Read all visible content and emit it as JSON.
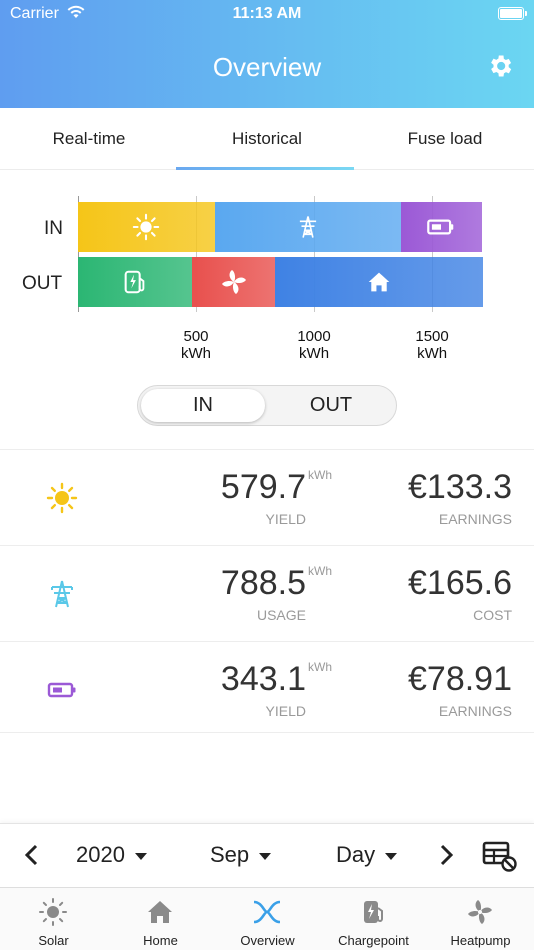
{
  "status_bar": {
    "carrier": "Carrier",
    "time": "11:13 AM"
  },
  "header": {
    "title": "Overview"
  },
  "tabs": [
    {
      "label": "Real-time"
    },
    {
      "label": "Historical",
      "active": true
    },
    {
      "label": "Fuse load"
    }
  ],
  "chart_data": {
    "type": "bar",
    "orientation": "horizontal-stacked",
    "categories": [
      "IN",
      "OUT"
    ],
    "series": [
      {
        "row": "IN",
        "icon": "sun-icon",
        "value": 579.7,
        "color": "#f5c518"
      },
      {
        "row": "IN",
        "icon": "power-tower-icon",
        "value": 788.5,
        "color": "#5aa8f0"
      },
      {
        "row": "IN",
        "icon": "battery-icon",
        "value": 343.1,
        "color": "#9b59d6"
      },
      {
        "row": "OUT",
        "icon": "charging-station-icon",
        "value": 485,
        "color": "#2bb673"
      },
      {
        "row": "OUT",
        "icon": "fan-icon",
        "value": 350,
        "color": "#e8504d"
      },
      {
        "row": "OUT",
        "icon": "home-icon",
        "value": 880,
        "color": "#3f82e4"
      }
    ],
    "xlim": [
      0,
      1720
    ],
    "xticks": [
      {
        "value": 500,
        "label_top": "500",
        "label_bottom": "kWh"
      },
      {
        "value": 1000,
        "label_top": "1000",
        "label_bottom": "kWh"
      },
      {
        "value": 1500,
        "label_top": "1500",
        "label_bottom": "kWh"
      }
    ],
    "grid": true
  },
  "toggle": {
    "in_label": "IN",
    "out_label": "OUT",
    "selected": "IN"
  },
  "stats": [
    {
      "icon": "sun-icon",
      "value": "579.7",
      "unit": "kWh",
      "value_label": "YIELD",
      "money": "€133.3",
      "money_label": "EARNINGS"
    },
    {
      "icon": "power-tower-icon",
      "value": "788.5",
      "unit": "kWh",
      "value_label": "USAGE",
      "money": "€165.6",
      "money_label": "COST"
    },
    {
      "icon": "battery-icon",
      "value": "343.1",
      "unit": "kWh",
      "value_label": "YIELD",
      "money": "€78.91",
      "money_label": "EARNINGS"
    }
  ],
  "period_selector": {
    "year": "2020",
    "month": "Sep",
    "granularity": "Day"
  },
  "tabbar": [
    {
      "label": "Solar",
      "icon": "sun-icon"
    },
    {
      "label": "Home",
      "icon": "home-icon"
    },
    {
      "label": "Overview",
      "icon": "overview-icon",
      "active": true,
      "color": "#3aa0e8"
    },
    {
      "label": "Chargepoint",
      "icon": "charging-station-icon"
    },
    {
      "label": "Heatpump",
      "icon": "fan-icon"
    }
  ]
}
